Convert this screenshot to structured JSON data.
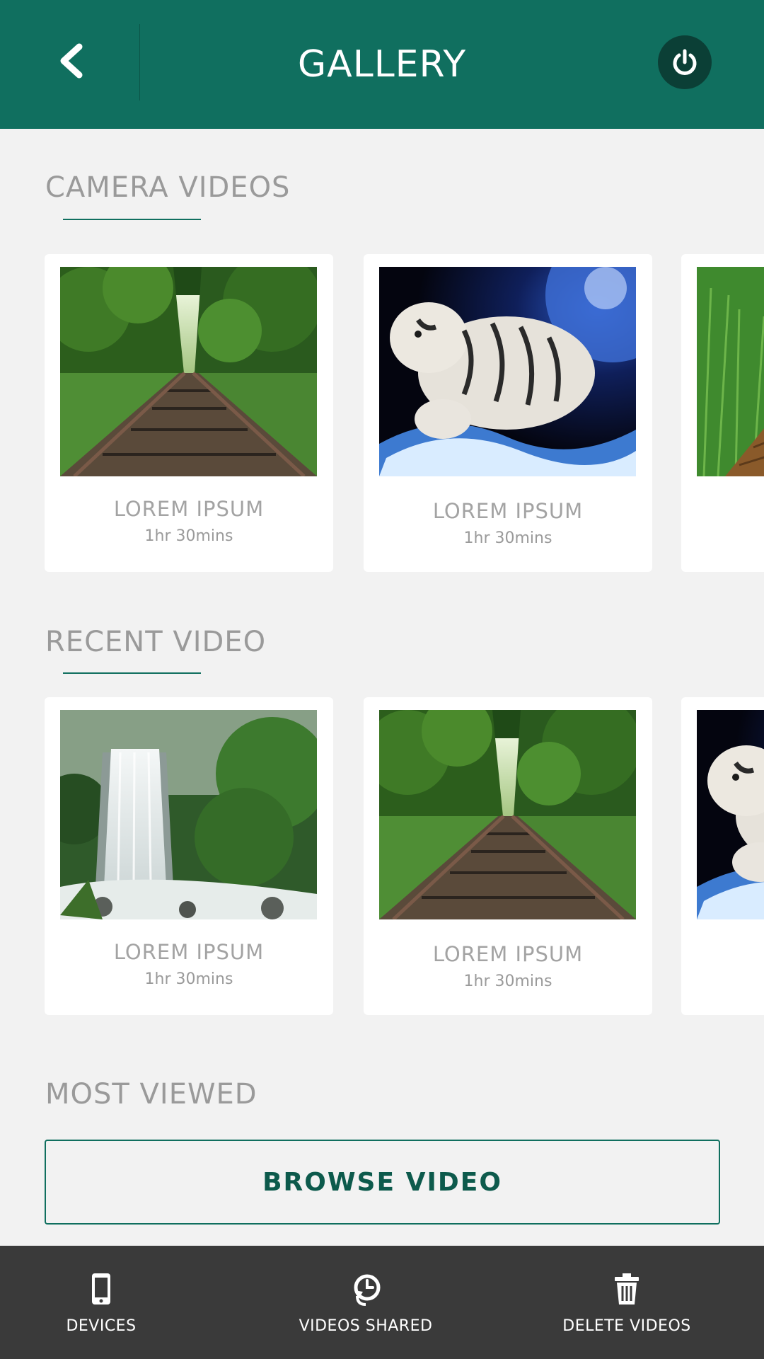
{
  "header": {
    "title": "GALLERY",
    "back_icon": "chevron-left-icon",
    "power_icon": "power-icon"
  },
  "sections": {
    "camera": {
      "title": "CAMERA VIDEOS",
      "cards": [
        {
          "title": "LOREM IPSUM",
          "duration": "1hr 30mins",
          "image": "railway-forest"
        },
        {
          "title": "LOREM IPSUM",
          "duration": "1hr 30mins",
          "image": "white-tiger-splash"
        },
        {
          "title": "",
          "duration": "",
          "image": "forest-path"
        }
      ]
    },
    "recent": {
      "title": "RECENT VIDEO",
      "cards": [
        {
          "title": "LOREM IPSUM",
          "duration": "1hr 30mins",
          "image": "waterfall"
        },
        {
          "title": "LOREM IPSUM",
          "duration": "1hr 30mins",
          "image": "railway-forest"
        },
        {
          "title": "",
          "duration": "",
          "image": "white-tiger-splash"
        }
      ]
    },
    "most_viewed": {
      "title": "MOST VIEWED",
      "button_label": "BROWSE VIDEO"
    }
  },
  "bottom_nav": {
    "items": [
      {
        "label": "DEVICES",
        "icon": "phone-icon"
      },
      {
        "label": "VIDEOS SHARED",
        "icon": "clock-share-icon"
      },
      {
        "label": "DELETE VIDEOS",
        "icon": "trash-icon"
      }
    ]
  },
  "colors": {
    "header": "#106f5f",
    "background": "#f2f2f2",
    "bottom_nav": "#3a3a3a",
    "accent_text": "#0d5a4c"
  }
}
